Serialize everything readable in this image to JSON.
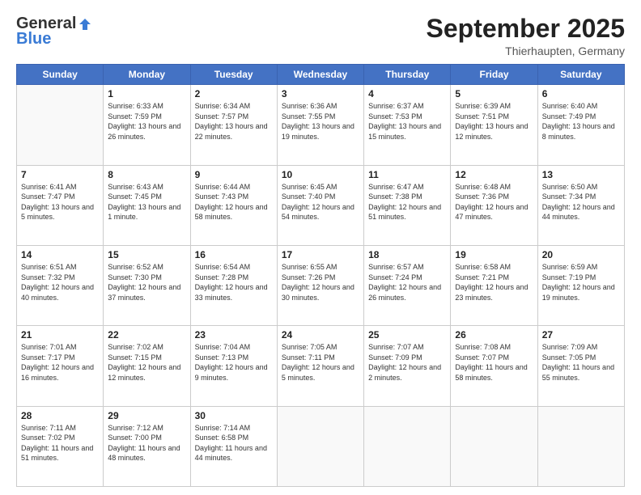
{
  "header": {
    "logo_general": "General",
    "logo_blue": "Blue",
    "month_title": "September 2025",
    "location": "Thierhaupten, Germany"
  },
  "days_of_week": [
    "Sunday",
    "Monday",
    "Tuesday",
    "Wednesday",
    "Thursday",
    "Friday",
    "Saturday"
  ],
  "weeks": [
    [
      {
        "day": "",
        "sunrise": "",
        "sunset": "",
        "daylight": ""
      },
      {
        "day": "1",
        "sunrise": "Sunrise: 6:33 AM",
        "sunset": "Sunset: 7:59 PM",
        "daylight": "Daylight: 13 hours and 26 minutes."
      },
      {
        "day": "2",
        "sunrise": "Sunrise: 6:34 AM",
        "sunset": "Sunset: 7:57 PM",
        "daylight": "Daylight: 13 hours and 22 minutes."
      },
      {
        "day": "3",
        "sunrise": "Sunrise: 6:36 AM",
        "sunset": "Sunset: 7:55 PM",
        "daylight": "Daylight: 13 hours and 19 minutes."
      },
      {
        "day": "4",
        "sunrise": "Sunrise: 6:37 AM",
        "sunset": "Sunset: 7:53 PM",
        "daylight": "Daylight: 13 hours and 15 minutes."
      },
      {
        "day": "5",
        "sunrise": "Sunrise: 6:39 AM",
        "sunset": "Sunset: 7:51 PM",
        "daylight": "Daylight: 13 hours and 12 minutes."
      },
      {
        "day": "6",
        "sunrise": "Sunrise: 6:40 AM",
        "sunset": "Sunset: 7:49 PM",
        "daylight": "Daylight: 13 hours and 8 minutes."
      }
    ],
    [
      {
        "day": "7",
        "sunrise": "Sunrise: 6:41 AM",
        "sunset": "Sunset: 7:47 PM",
        "daylight": "Daylight: 13 hours and 5 minutes."
      },
      {
        "day": "8",
        "sunrise": "Sunrise: 6:43 AM",
        "sunset": "Sunset: 7:45 PM",
        "daylight": "Daylight: 13 hours and 1 minute."
      },
      {
        "day": "9",
        "sunrise": "Sunrise: 6:44 AM",
        "sunset": "Sunset: 7:43 PM",
        "daylight": "Daylight: 12 hours and 58 minutes."
      },
      {
        "day": "10",
        "sunrise": "Sunrise: 6:45 AM",
        "sunset": "Sunset: 7:40 PM",
        "daylight": "Daylight: 12 hours and 54 minutes."
      },
      {
        "day": "11",
        "sunrise": "Sunrise: 6:47 AM",
        "sunset": "Sunset: 7:38 PM",
        "daylight": "Daylight: 12 hours and 51 minutes."
      },
      {
        "day": "12",
        "sunrise": "Sunrise: 6:48 AM",
        "sunset": "Sunset: 7:36 PM",
        "daylight": "Daylight: 12 hours and 47 minutes."
      },
      {
        "day": "13",
        "sunrise": "Sunrise: 6:50 AM",
        "sunset": "Sunset: 7:34 PM",
        "daylight": "Daylight: 12 hours and 44 minutes."
      }
    ],
    [
      {
        "day": "14",
        "sunrise": "Sunrise: 6:51 AM",
        "sunset": "Sunset: 7:32 PM",
        "daylight": "Daylight: 12 hours and 40 minutes."
      },
      {
        "day": "15",
        "sunrise": "Sunrise: 6:52 AM",
        "sunset": "Sunset: 7:30 PM",
        "daylight": "Daylight: 12 hours and 37 minutes."
      },
      {
        "day": "16",
        "sunrise": "Sunrise: 6:54 AM",
        "sunset": "Sunset: 7:28 PM",
        "daylight": "Daylight: 12 hours and 33 minutes."
      },
      {
        "day": "17",
        "sunrise": "Sunrise: 6:55 AM",
        "sunset": "Sunset: 7:26 PM",
        "daylight": "Daylight: 12 hours and 30 minutes."
      },
      {
        "day": "18",
        "sunrise": "Sunrise: 6:57 AM",
        "sunset": "Sunset: 7:24 PM",
        "daylight": "Daylight: 12 hours and 26 minutes."
      },
      {
        "day": "19",
        "sunrise": "Sunrise: 6:58 AM",
        "sunset": "Sunset: 7:21 PM",
        "daylight": "Daylight: 12 hours and 23 minutes."
      },
      {
        "day": "20",
        "sunrise": "Sunrise: 6:59 AM",
        "sunset": "Sunset: 7:19 PM",
        "daylight": "Daylight: 12 hours and 19 minutes."
      }
    ],
    [
      {
        "day": "21",
        "sunrise": "Sunrise: 7:01 AM",
        "sunset": "Sunset: 7:17 PM",
        "daylight": "Daylight: 12 hours and 16 minutes."
      },
      {
        "day": "22",
        "sunrise": "Sunrise: 7:02 AM",
        "sunset": "Sunset: 7:15 PM",
        "daylight": "Daylight: 12 hours and 12 minutes."
      },
      {
        "day": "23",
        "sunrise": "Sunrise: 7:04 AM",
        "sunset": "Sunset: 7:13 PM",
        "daylight": "Daylight: 12 hours and 9 minutes."
      },
      {
        "day": "24",
        "sunrise": "Sunrise: 7:05 AM",
        "sunset": "Sunset: 7:11 PM",
        "daylight": "Daylight: 12 hours and 5 minutes."
      },
      {
        "day": "25",
        "sunrise": "Sunrise: 7:07 AM",
        "sunset": "Sunset: 7:09 PM",
        "daylight": "Daylight: 12 hours and 2 minutes."
      },
      {
        "day": "26",
        "sunrise": "Sunrise: 7:08 AM",
        "sunset": "Sunset: 7:07 PM",
        "daylight": "Daylight: 11 hours and 58 minutes."
      },
      {
        "day": "27",
        "sunrise": "Sunrise: 7:09 AM",
        "sunset": "Sunset: 7:05 PM",
        "daylight": "Daylight: 11 hours and 55 minutes."
      }
    ],
    [
      {
        "day": "28",
        "sunrise": "Sunrise: 7:11 AM",
        "sunset": "Sunset: 7:02 PM",
        "daylight": "Daylight: 11 hours and 51 minutes."
      },
      {
        "day": "29",
        "sunrise": "Sunrise: 7:12 AM",
        "sunset": "Sunset: 7:00 PM",
        "daylight": "Daylight: 11 hours and 48 minutes."
      },
      {
        "day": "30",
        "sunrise": "Sunrise: 7:14 AM",
        "sunset": "Sunset: 6:58 PM",
        "daylight": "Daylight: 11 hours and 44 minutes."
      },
      {
        "day": "",
        "sunrise": "",
        "sunset": "",
        "daylight": ""
      },
      {
        "day": "",
        "sunrise": "",
        "sunset": "",
        "daylight": ""
      },
      {
        "day": "",
        "sunrise": "",
        "sunset": "",
        "daylight": ""
      },
      {
        "day": "",
        "sunrise": "",
        "sunset": "",
        "daylight": ""
      }
    ]
  ]
}
